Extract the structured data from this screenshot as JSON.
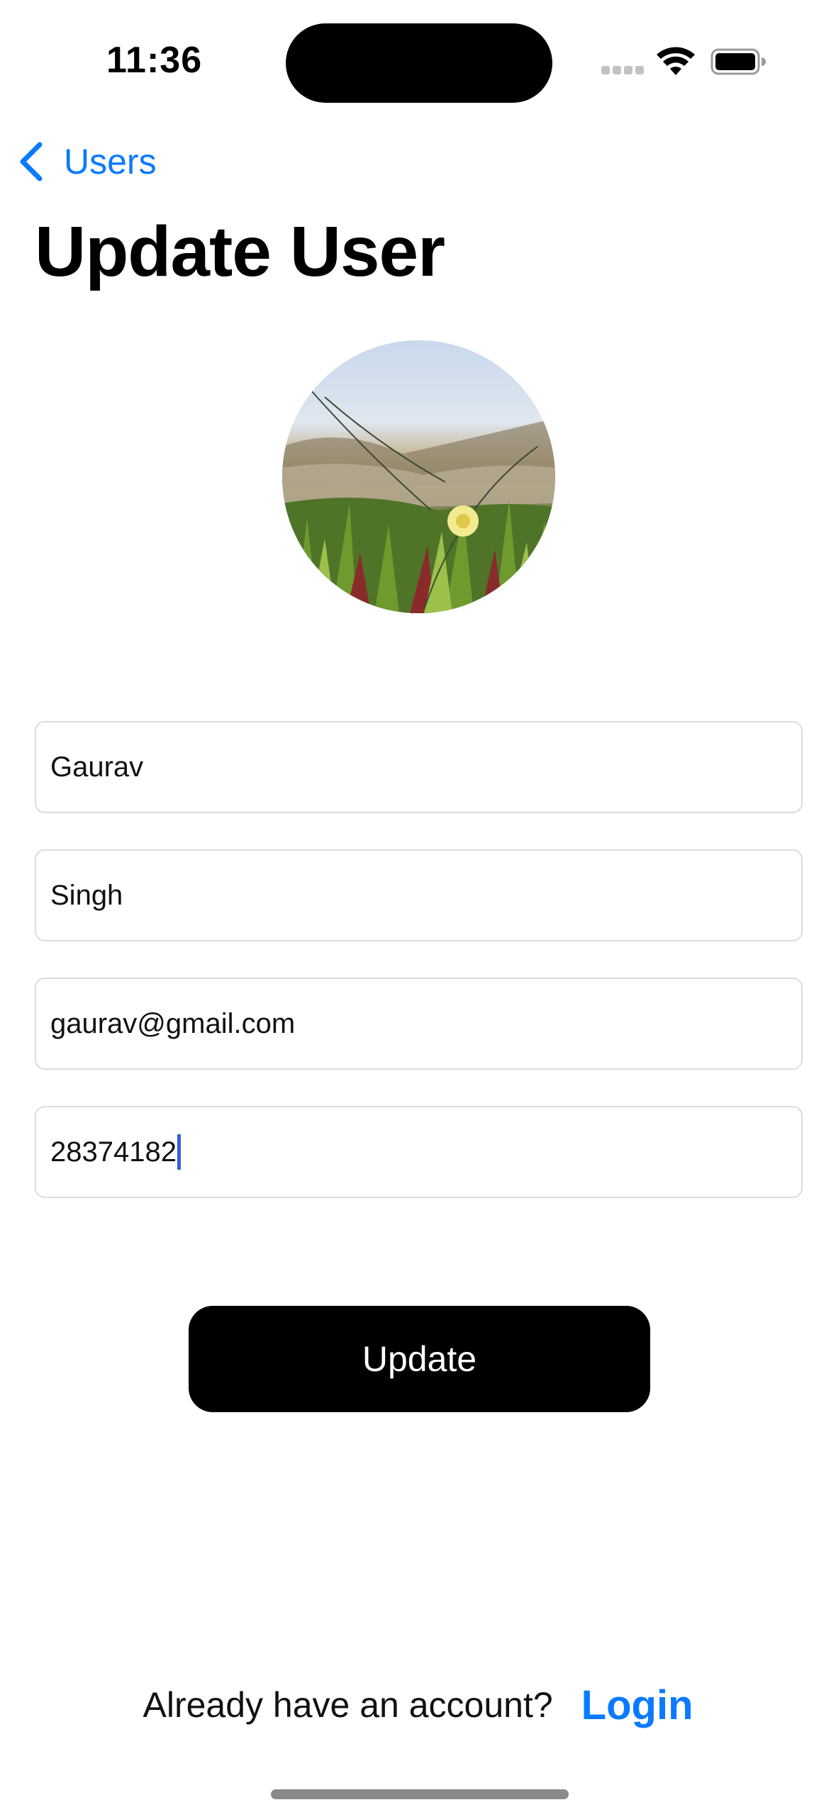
{
  "status_bar": {
    "time": "11:36"
  },
  "nav": {
    "back_label": "Users"
  },
  "page": {
    "title": "Update User"
  },
  "form": {
    "first_name": "Gaurav",
    "last_name": "Singh",
    "email": "gaurav@gmail.com",
    "phone": "28374182"
  },
  "actions": {
    "update_label": "Update"
  },
  "footer": {
    "prompt": "Already have an account?",
    "login_label": "Login"
  },
  "colors": {
    "accent": "#0a7aff",
    "button_bg": "#000000",
    "button_text": "#ffffff",
    "field_border": "#dcdcdc"
  },
  "icons": {
    "back": "chevron-left-icon",
    "wifi": "wifi-icon",
    "battery": "battery-icon",
    "signal": "signal-icon"
  }
}
